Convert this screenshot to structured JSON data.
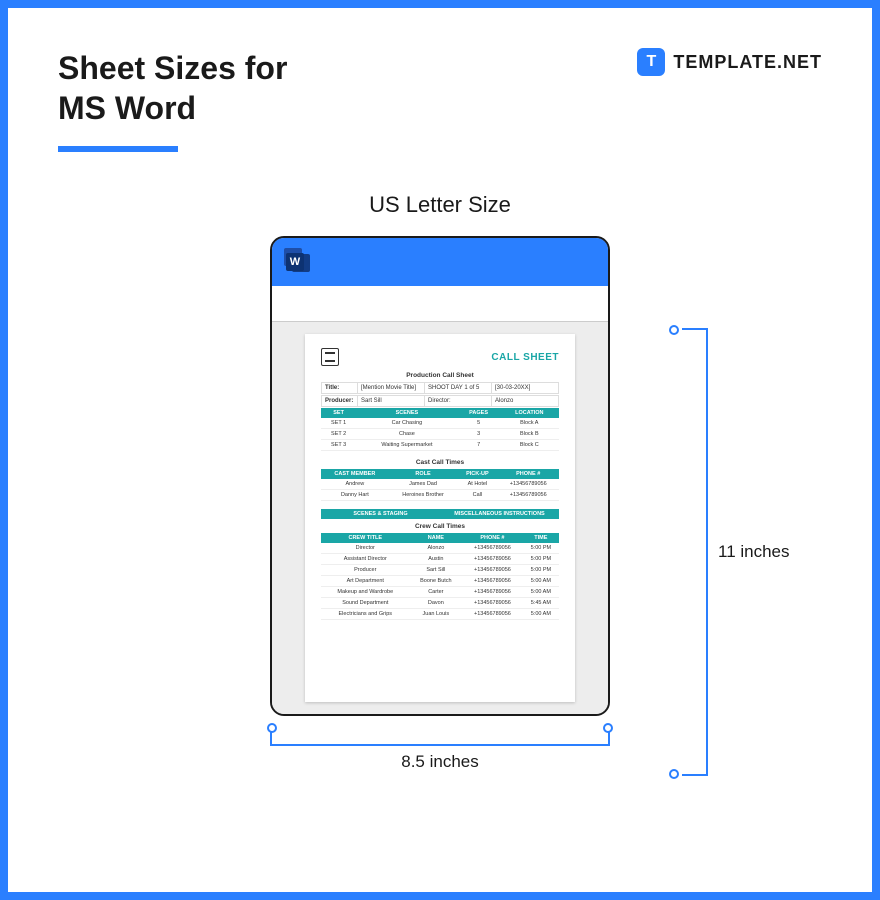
{
  "header": {
    "title_line1": "Sheet Sizes for",
    "title_line2": "MS Word"
  },
  "brand": {
    "icon_letter": "T",
    "text": "TEMPLATE.NET"
  },
  "size_label": "US Letter Size",
  "word_letter": "W",
  "doc": {
    "title": "CALL SHEET",
    "section1": "Production Call Sheet",
    "info": [
      {
        "lbl": "Title:",
        "v1": "[Mention Movie Title]",
        "v2": "SHOOT DAY 1 of 5",
        "v3": "[30-03-20XX]"
      },
      {
        "lbl": "Producer:",
        "v1": "Sart Sill",
        "v2": "Director:",
        "v3": "Alonzo"
      }
    ],
    "table1": {
      "headers": [
        "SET",
        "SCENES",
        "PAGES",
        "LOCATION"
      ],
      "rows": [
        [
          "SET 1",
          "Car Chasing",
          "5",
          "Block A"
        ],
        [
          "SET 2",
          "Chase",
          "3",
          "Block B"
        ],
        [
          "SET 3",
          "Waiting Supermarket",
          "7",
          "Block C"
        ]
      ]
    },
    "section2": "Cast Call Times",
    "table2": {
      "headers": [
        "CAST MEMBER",
        "ROLE",
        "PICK-UP",
        "PHONE #"
      ],
      "rows": [
        [
          "Andrew",
          "James Dad",
          "At Hotel",
          "+13456789056"
        ],
        [
          "Danny Hart",
          "Heroines Brother",
          "Call",
          "+13456789056"
        ]
      ],
      "sub": [
        "SCENES & STAGING",
        "MISCELLANEOUS INSTRUCTIONS"
      ]
    },
    "section3": "Crew Call Times",
    "table3": {
      "headers": [
        "CREW TITLE",
        "NAME",
        "PHONE #",
        "TIME"
      ],
      "rows": [
        [
          "Director",
          "Alonzo",
          "+13456789056",
          "5:00 PM"
        ],
        [
          "Assistant Director",
          "Austin",
          "+13456789056",
          "5:00 PM"
        ],
        [
          "Producer",
          "Sart Sill",
          "+13456789056",
          "5:00 PM"
        ],
        [
          "Art Department",
          "Boone Butch",
          "+13456789056",
          "5:00 AM"
        ],
        [
          "Makeup and Wardrobe",
          "Carter",
          "+13456789056",
          "5:00 AM"
        ],
        [
          "Sound Department",
          "Davon",
          "+13456789056",
          "5:45 AM"
        ],
        [
          "Electricians and Grips",
          "Juan Louis",
          "+13456789056",
          "5:00 AM"
        ]
      ]
    }
  },
  "dimensions": {
    "width": "8.5 inches",
    "height": "11 inches"
  }
}
